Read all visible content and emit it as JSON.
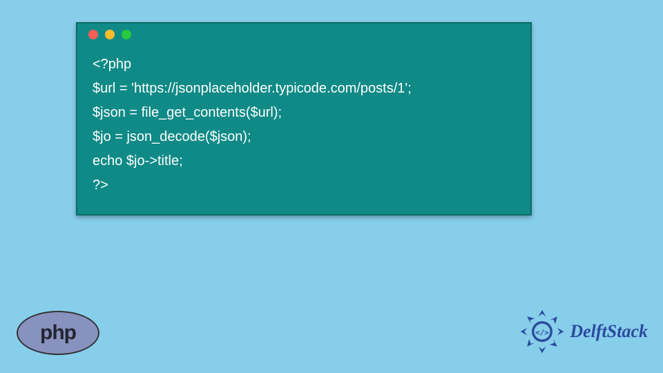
{
  "code": {
    "lines": [
      "<?php",
      "$url = 'https://jsonplaceholder.typicode.com/posts/1';",
      "$json = file_get_contents($url);",
      "$jo = json_decode($json);",
      "echo $jo->title;",
      "?>"
    ]
  },
  "php_badge": {
    "text": "php"
  },
  "delft": {
    "text": "DelftStack"
  }
}
